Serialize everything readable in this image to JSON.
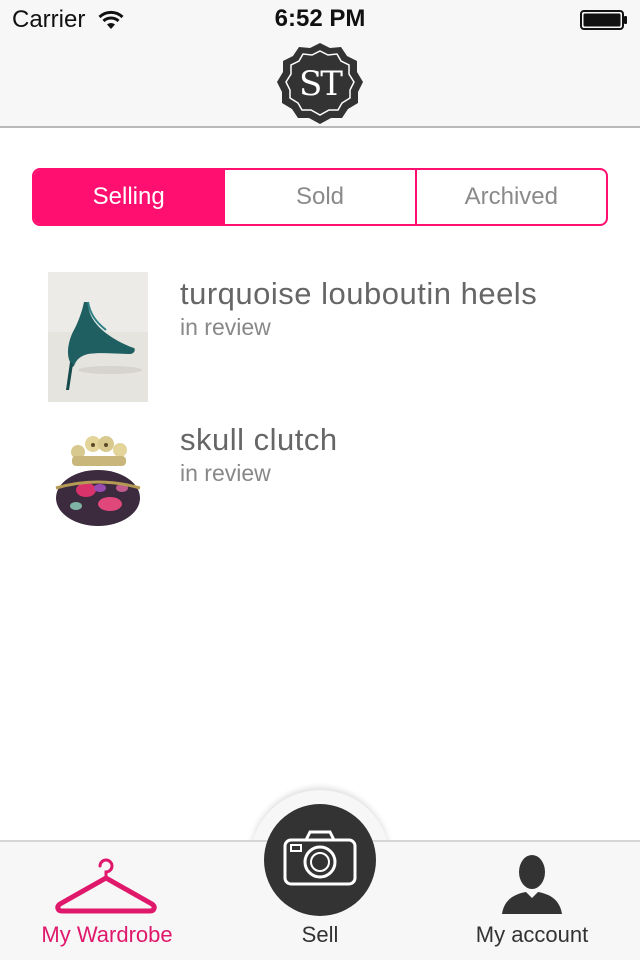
{
  "status_bar": {
    "carrier": "Carrier",
    "time": "6:52 PM"
  },
  "header": {
    "logo_text": "ST",
    "logo_icon": "st-badge-logo"
  },
  "segments": [
    {
      "label": "Selling",
      "active": true
    },
    {
      "label": "Sold",
      "active": false
    },
    {
      "label": "Archived",
      "active": false
    }
  ],
  "items": [
    {
      "title": "turquoise louboutin heels",
      "status": "in review",
      "thumb_icon": "teal-heel-photo"
    },
    {
      "title": "skull clutch",
      "status": "in review",
      "thumb_icon": "skull-clutch-photo"
    }
  ],
  "tabbar": {
    "wardrobe_label": "My Wardrobe",
    "sell_label": "Sell",
    "account_label": "My account",
    "active_tab": "My Wardrobe"
  },
  "colors": {
    "accent": "#ff0f6f",
    "active_tab_text": "#e0186c",
    "sell_button": "#333333"
  }
}
